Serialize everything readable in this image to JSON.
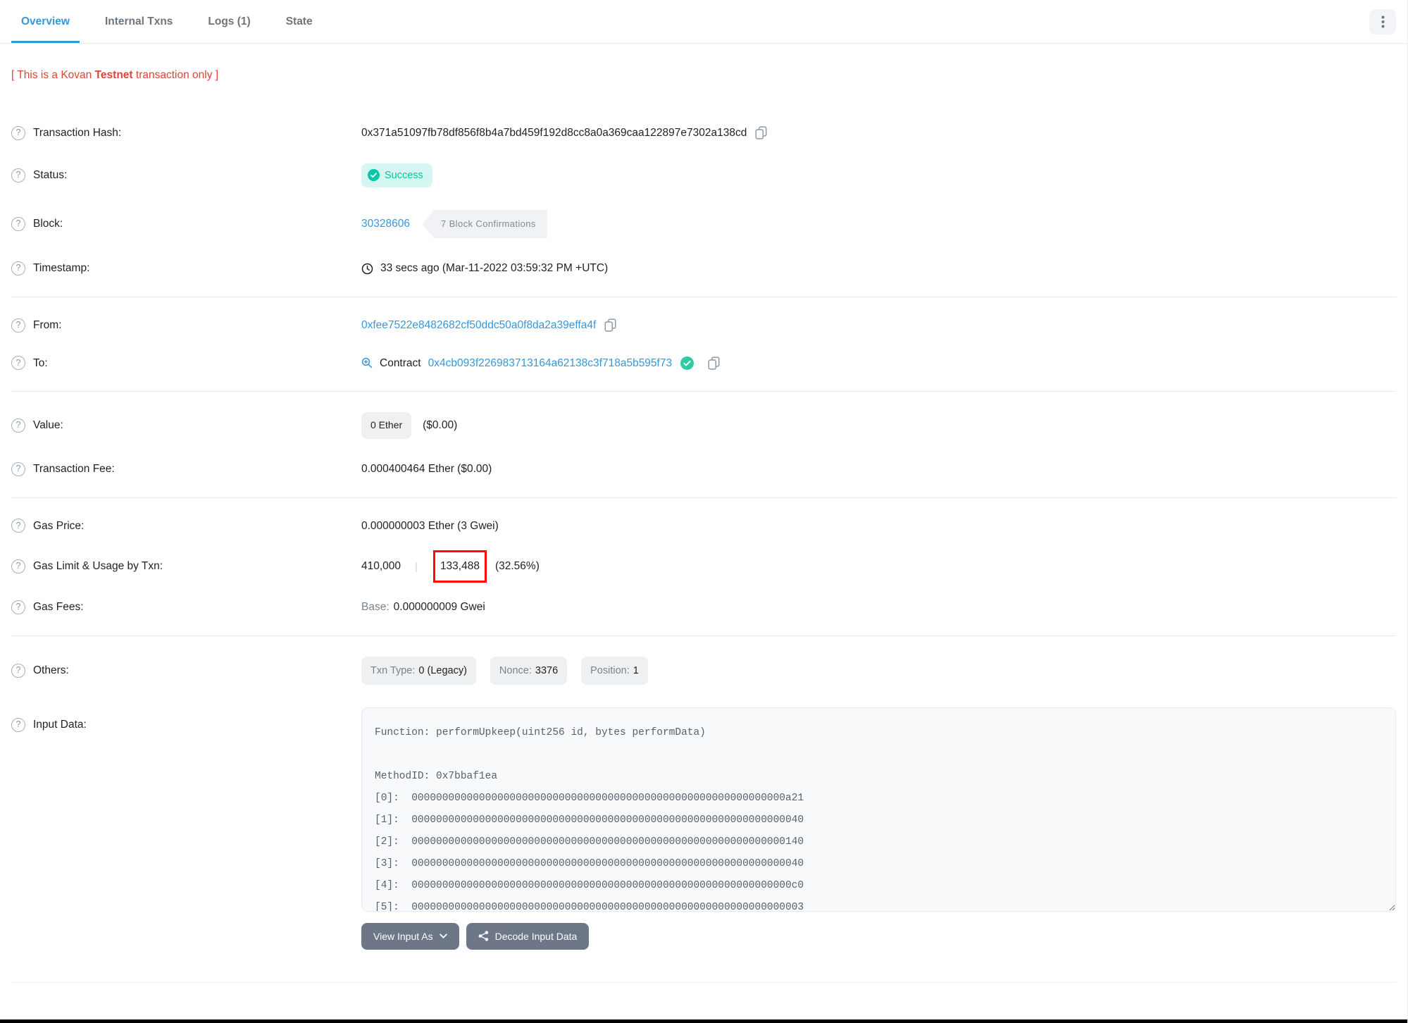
{
  "tabs": [
    {
      "label": "Overview",
      "active": true
    },
    {
      "label": "Internal Txns",
      "active": false
    },
    {
      "label": "Logs (1)",
      "active": false
    },
    {
      "label": "State",
      "active": false
    }
  ],
  "notice": {
    "prefix": "[ This is a Kovan ",
    "bold": "Testnet",
    "suffix": " transaction only ]"
  },
  "rows": {
    "transaction_hash": {
      "label": "Transaction Hash:",
      "value": "0x371a51097fb78df856f8b4a7bd459f192d8cc8a0a369caa122897e7302a138cd"
    },
    "status": {
      "label": "Status:",
      "value": "Success"
    },
    "block": {
      "label": "Block:",
      "number": "30328606",
      "confirmations": "7 Block Confirmations"
    },
    "timestamp": {
      "label": "Timestamp:",
      "value": "33 secs ago (Mar-11-2022 03:59:32 PM +UTC)"
    },
    "from": {
      "label": "From:",
      "address": "0xfee7522e8482682cf50ddc50a0f8da2a39effa4f"
    },
    "to": {
      "label": "To:",
      "type_label": "Contract",
      "address": "0x4cb093f226983713164a62138c3f718a5b595f73"
    },
    "value": {
      "label": "Value:",
      "badge": "0 Ether",
      "usd": "($0.00)"
    },
    "transaction_fee": {
      "label": "Transaction Fee:",
      "value": "0.000400464 Ether ($0.00)"
    },
    "gas_price": {
      "label": "Gas Price:",
      "value": "0.000000003 Ether (3 Gwei)"
    },
    "gas_limit": {
      "label": "Gas Limit & Usage by Txn:",
      "limit": "410,000",
      "separator": "|",
      "used": "133,488",
      "percent": "(32.56%)"
    },
    "gas_fees": {
      "label": "Gas Fees:",
      "base_label": "Base:",
      "base_value": "0.000000009 Gwei"
    },
    "others": {
      "label": "Others:",
      "badges": [
        {
          "k": "Txn Type:",
          "v": "0 (Legacy)"
        },
        {
          "k": "Nonce:",
          "v": "3376"
        },
        {
          "k": "Position:",
          "v": "1"
        }
      ]
    },
    "input_data": {
      "label": "Input Data:",
      "content": "Function: performUpkeep(uint256 id, bytes performData)\n\nMethodID: 0x7bbaf1ea\n[0]:  0000000000000000000000000000000000000000000000000000000000000a21\n[1]:  0000000000000000000000000000000000000000000000000000000000000040\n[2]:  0000000000000000000000000000000000000000000000000000000000000140\n[3]:  0000000000000000000000000000000000000000000000000000000000000040\n[4]:  00000000000000000000000000000000000000000000000000000000000000c0\n[5]:  0000000000000000000000000000000000000000000000000000000000000003"
    }
  },
  "buttons": {
    "view_input_as": "View Input As",
    "decode_input_data": "Decode Input Data"
  },
  "icons": {
    "help_icon": "?",
    "kebab_icon": "vertical three dots",
    "copy_icon": "two overlapping documents",
    "clock_icon": "clock outline",
    "zoom_in_icon": "magnifier with plus",
    "check_circle_icon": "teal circle with white check",
    "chevron_down_icon": "caret down",
    "decode_icon": "connected nodes"
  },
  "colors": {
    "accent_blue": "#3498db",
    "success_teal": "#00c9a7",
    "danger_red": "#de4437",
    "text_dark": "#1e2022",
    "text_muted": "#77838f",
    "border": "#e7eaf3",
    "annotation_red": "#fd0800",
    "button_gray": "#6e7787"
  }
}
